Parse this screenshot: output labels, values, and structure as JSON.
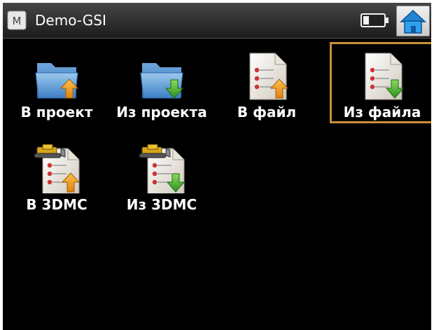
{
  "window": {
    "title": "Demo-GSI",
    "app_icon_letter": "M"
  },
  "tiles": [
    {
      "label": "В проект",
      "icon": "folder-import-icon",
      "selected": false
    },
    {
      "label": "Из проекта",
      "icon": "folder-export-icon",
      "selected": false
    },
    {
      "label": "В файл",
      "icon": "file-import-icon",
      "selected": false
    },
    {
      "label": "Из файла",
      "icon": "file-export-icon",
      "selected": true
    },
    {
      "label": "В 3DMC",
      "icon": "3dmc-import-icon",
      "selected": false
    },
    {
      "label": "Из 3DMC",
      "icon": "3dmc-export-icon",
      "selected": false
    }
  ],
  "colors": {
    "background": "#000000",
    "selection_border": "#c8903a",
    "folder_blue": "#5b9bd5",
    "arrow_orange": "#f0a030",
    "arrow_green": "#3caa2a"
  }
}
